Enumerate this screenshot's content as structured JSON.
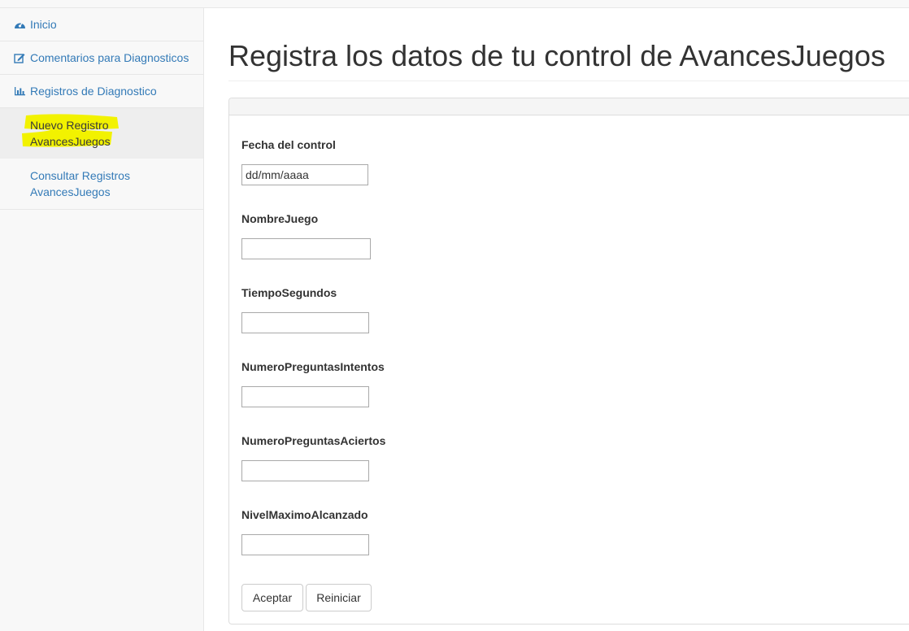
{
  "sidebar": {
    "items": [
      {
        "label": "Inicio",
        "icon": "dashboard-icon"
      },
      {
        "label": "Comentarios para Diagnosticos",
        "icon": "edit-icon"
      },
      {
        "label": "Registros de Diagnostico",
        "icon": "bar-chart-icon"
      }
    ],
    "subitems": [
      {
        "line1": "Nuevo Registro",
        "line2": "AvancesJuegos",
        "active": true
      },
      {
        "line1": "Consultar Registros",
        "line2": "AvancesJuegos",
        "active": false
      }
    ]
  },
  "page": {
    "title": "Registra los datos de tu control de AvancesJuegos"
  },
  "form": {
    "fields": [
      {
        "label": "Fecha del control",
        "value": "dd/mm/aaaa"
      },
      {
        "label": "NombreJuego",
        "value": ""
      },
      {
        "label": "TiempoSegundos",
        "value": ""
      },
      {
        "label": "NumeroPreguntasIntentos",
        "value": ""
      },
      {
        "label": "NumeroPreguntasAciertos",
        "value": ""
      },
      {
        "label": "NivelMaximoAlcanzado",
        "value": ""
      }
    ],
    "submit_label": "Aceptar",
    "reset_label": "Reiniciar"
  },
  "colors": {
    "link": "#337ab7",
    "highlight": "#f2f200"
  }
}
